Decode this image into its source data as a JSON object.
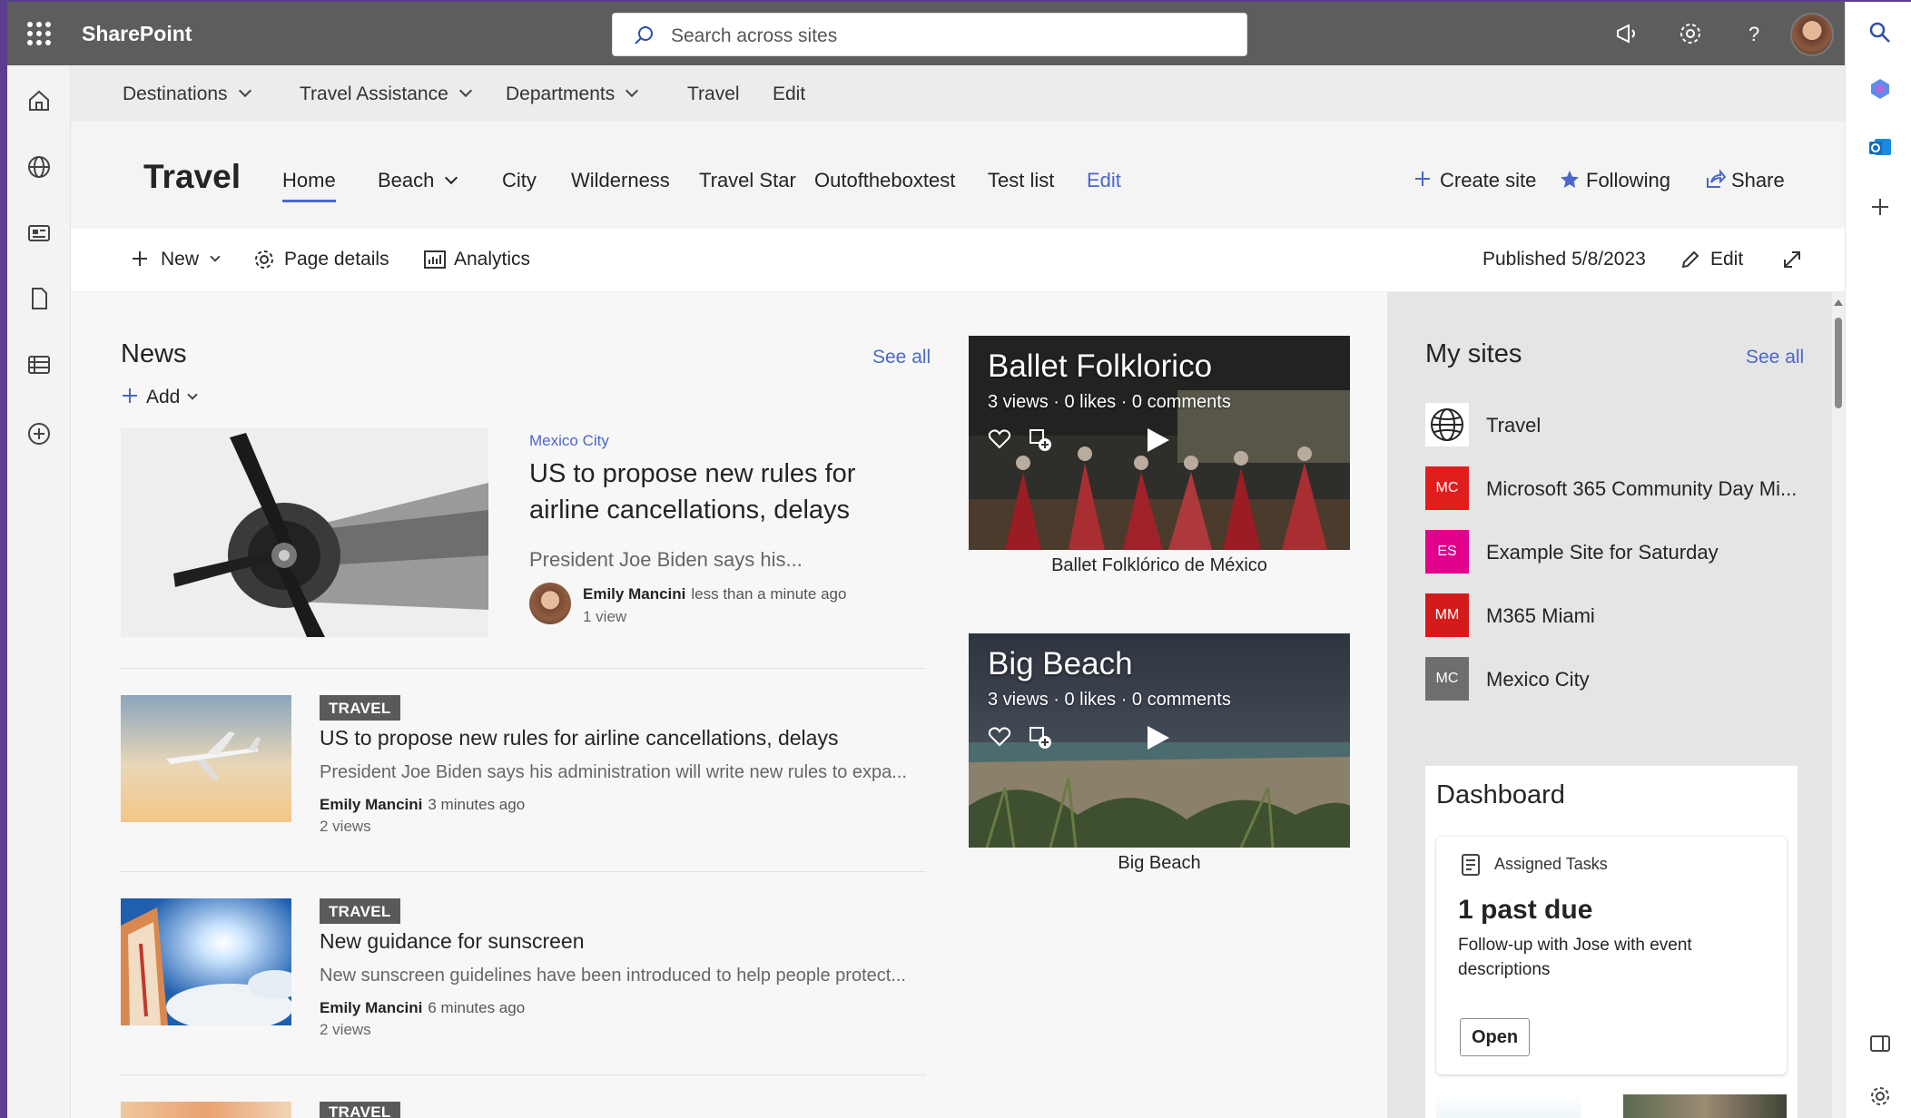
{
  "suite": {
    "app_name": "SharePoint",
    "search_placeholder": "Search across sites"
  },
  "hub_nav": [
    {
      "label": "Destinations",
      "has_menu": true
    },
    {
      "label": "Travel Assistance",
      "has_menu": true
    },
    {
      "label": "Departments",
      "has_menu": true
    },
    {
      "label": "Travel",
      "has_menu": false
    },
    {
      "label": "Edit",
      "has_menu": false
    }
  ],
  "site": {
    "title": "Travel",
    "nav": [
      {
        "label": "Home",
        "active": true
      },
      {
        "label": "Beach",
        "has_menu": true
      },
      {
        "label": "City"
      },
      {
        "label": "Wilderness"
      },
      {
        "label": "Travel Star"
      },
      {
        "label": "Outoftheboxtest"
      },
      {
        "label": "Test list"
      },
      {
        "label": "Edit"
      }
    ],
    "actions": {
      "create_site": "Create site",
      "following": "Following",
      "share": "Share"
    }
  },
  "command_bar": {
    "new": "New",
    "page_details": "Page details",
    "analytics": "Analytics",
    "published": "Published 5/8/2023",
    "edit": "Edit"
  },
  "news": {
    "title": "News",
    "see_all": "See all",
    "add": "Add",
    "hero": {
      "tag": "Mexico City",
      "title": "US to propose new rules for airline cancellations, delays",
      "description": "President Joe Biden says his...",
      "author": "Emily Mancini",
      "time": "less than a minute ago",
      "views": "1 view"
    },
    "items": [
      {
        "badge": "TRAVEL",
        "title": "US to propose new rules for airline cancellations, delays",
        "description": "President Joe Biden says his administration will write new rules to expa...",
        "author": "Emily Mancini",
        "time": "3 minutes ago",
        "views": "2 views"
      },
      {
        "badge": "TRAVEL",
        "title": "New guidance for sunscreen",
        "description": "New sunscreen guidelines have been introduced to help people protect...",
        "author": "Emily Mancini",
        "time": "6 minutes ago",
        "views": "2 views"
      },
      {
        "badge": "TRAVEL"
      }
    ]
  },
  "videos": [
    {
      "title": "Ballet Folklorico",
      "stats": "3 views · 0 likes · 0 comments",
      "caption": "Ballet Folklórico de México"
    },
    {
      "title": "Big Beach",
      "stats": "3 views · 0 likes · 0 comments",
      "caption": "Big Beach"
    }
  ],
  "my_sites": {
    "title": "My sites",
    "see_all": "See all",
    "sites": [
      {
        "initials": "",
        "name": "Travel",
        "color": "#ffffff"
      },
      {
        "initials": "MC",
        "name": "Microsoft 365 Community Day Mi...",
        "color": "#e01e1e"
      },
      {
        "initials": "ES",
        "name": "Example Site for Saturday",
        "color": "#e3008c"
      },
      {
        "initials": "MM",
        "name": "M365 Miami",
        "color": "#d41b1b"
      },
      {
        "initials": "MC",
        "name": "Mexico City",
        "color": "#6e6e6e"
      }
    ]
  },
  "dashboard": {
    "title": "Dashboard",
    "card": {
      "header": "Assigned Tasks",
      "big": "1 past due",
      "text": "Follow-up with Jose with event descriptions",
      "button": "Open"
    }
  },
  "colors": {
    "accent": "#4a67c9",
    "suite_bar": "#5d5d5d",
    "badge": "#5a5a5a"
  }
}
